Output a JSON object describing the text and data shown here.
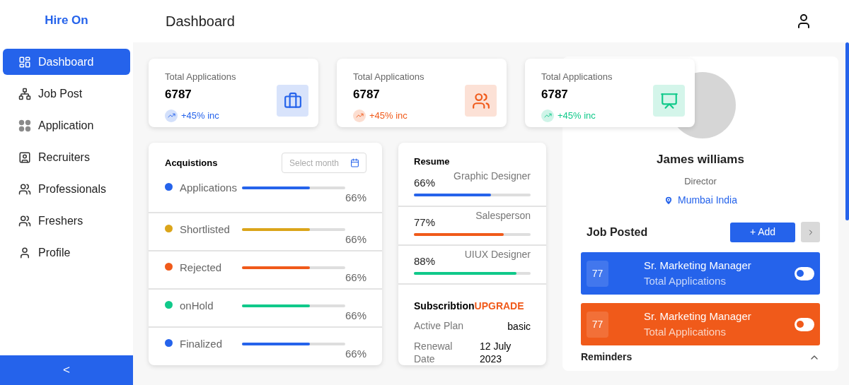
{
  "brand": "Hire On",
  "sidebar": {
    "items": [
      {
        "label": "Dashboard",
        "selected": true
      },
      {
        "label": "Job Post",
        "selected": false
      },
      {
        "label": "Application",
        "selected": false
      },
      {
        "label": "Recruiters",
        "selected": false
      },
      {
        "label": "Professionals",
        "selected": false
      },
      {
        "label": "Freshers",
        "selected": false
      },
      {
        "label": "Profile",
        "selected": false
      }
    ],
    "collapse": "<"
  },
  "header": {
    "title": "Dashboard"
  },
  "stats": [
    {
      "label": "Total Applications",
      "value": "6787",
      "change": "+45% inc",
      "color": "#2563eb"
    },
    {
      "label": "Total Applications",
      "value": "6787",
      "change": "+45% inc",
      "color": "#f05a1a"
    },
    {
      "label": "Total Applications",
      "value": "6787",
      "change": "+45% inc",
      "color": "#10c98a"
    }
  ],
  "acquisitions": {
    "title": "Acquistions",
    "placeholder": "Select month",
    "rows": [
      {
        "label": "Applications",
        "color": "#2563eb",
        "level": 0.66,
        "reading": "66%"
      },
      {
        "label": "Shortlisted",
        "color": "#dba51a",
        "level": 0.66,
        "reading": "66%"
      },
      {
        "label": "Rejected",
        "color": "#f05a1a",
        "level": 0.66,
        "reading": "66%"
      },
      {
        "label": "onHold",
        "color": "#10c98a",
        "level": 0.66,
        "reading": "66%"
      },
      {
        "label": "Finalized",
        "color": "#2563eb",
        "level": 0.66,
        "reading": "66%"
      }
    ]
  },
  "resume": {
    "title": "Resume",
    "rows": [
      {
        "role": "Graphic Designer",
        "reading": "66%",
        "level": 0.66,
        "color": "#2563eb"
      },
      {
        "role": "Salesperson",
        "reading": "77%",
        "level": 0.77,
        "color": "#f05a1a"
      },
      {
        "role": "UIUX Designer",
        "reading": "88%",
        "level": 0.88,
        "color": "#10c98a"
      }
    ],
    "subscription": {
      "title": "Subscribtion",
      "action": "UPGRADE",
      "fields": [
        {
          "label": "Active Plan",
          "value": "basic"
        },
        {
          "label": "Renewal Date",
          "value": "12 July 2023"
        }
      ]
    }
  },
  "profile": {
    "name": "James williams",
    "role": "Director",
    "location": "Mumbai India"
  },
  "jobs": {
    "title": "Job Posted",
    "add": "+ Add",
    "items": [
      {
        "count": "77",
        "title": "Sr. Marketing Manager",
        "subtitle": "Total Applications",
        "color": "#2563eb",
        "on": false
      },
      {
        "count": "77",
        "title": "Sr. Marketing Manager",
        "subtitle": "Total Applications",
        "color": "#f05a1a",
        "on": false
      }
    ]
  },
  "reminders": {
    "title": "Reminders",
    "expanded": true
  }
}
